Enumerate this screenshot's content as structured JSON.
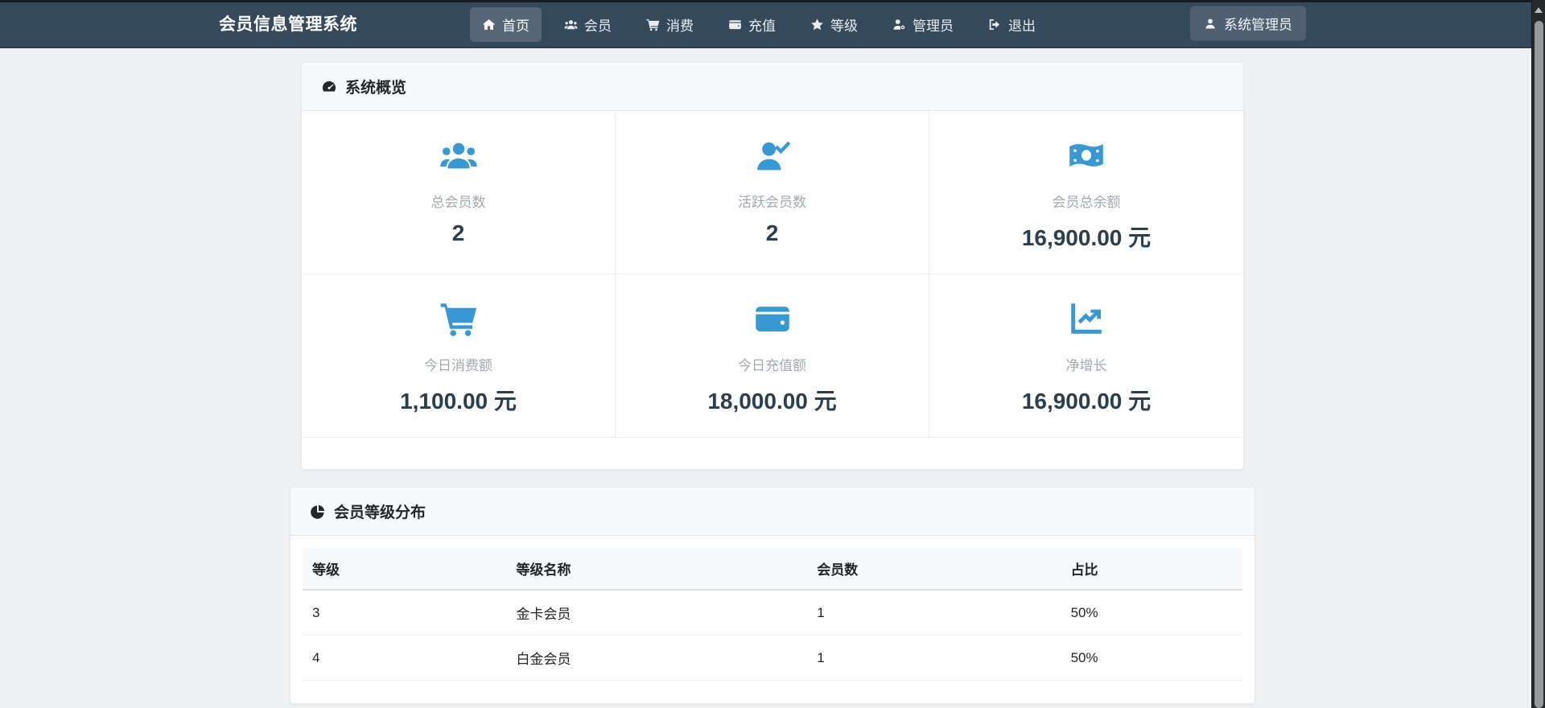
{
  "navbar": {
    "brand": "会员信息管理系统",
    "items": [
      {
        "label": "首页",
        "icon": "home",
        "active": true
      },
      {
        "label": "会员",
        "icon": "users",
        "active": false
      },
      {
        "label": "消费",
        "icon": "cart",
        "active": false
      },
      {
        "label": "充值",
        "icon": "wallet",
        "active": false
      },
      {
        "label": "等级",
        "icon": "star",
        "active": false
      },
      {
        "label": "管理员",
        "icon": "user-cog",
        "active": false
      },
      {
        "label": "退出",
        "icon": "sign-out",
        "active": false
      }
    ],
    "user_badge": {
      "label": "系统管理员",
      "icon": "user"
    }
  },
  "overview": {
    "title": "系统概览",
    "title_icon": "tachometer",
    "stats": [
      {
        "label": "总会员数",
        "value": "2",
        "icon": "users"
      },
      {
        "label": "活跃会员数",
        "value": "2",
        "icon": "user-check"
      },
      {
        "label": "会员总余额",
        "value": "16,900.00 元",
        "icon": "money"
      },
      {
        "label": "今日消费额",
        "value": "1,100.00 元",
        "icon": "cart"
      },
      {
        "label": "今日充值额",
        "value": "18,000.00 元",
        "icon": "wallet"
      },
      {
        "label": "净增长",
        "value": "16,900.00 元",
        "icon": "chart-line"
      }
    ]
  },
  "level_distribution": {
    "title": "会员等级分布",
    "title_icon": "pie",
    "columns": [
      "等级",
      "等级名称",
      "会员数",
      "占比"
    ],
    "rows": [
      [
        "3",
        "金卡会员",
        "1",
        "50%"
      ],
      [
        "4",
        "白金会员",
        "1",
        "50%"
      ]
    ]
  },
  "colors": {
    "navbar_bg": "#35495d",
    "accent_blue": "#3798d4",
    "value_text": "#2b3e50",
    "page_bg": "#eef0f2"
  }
}
